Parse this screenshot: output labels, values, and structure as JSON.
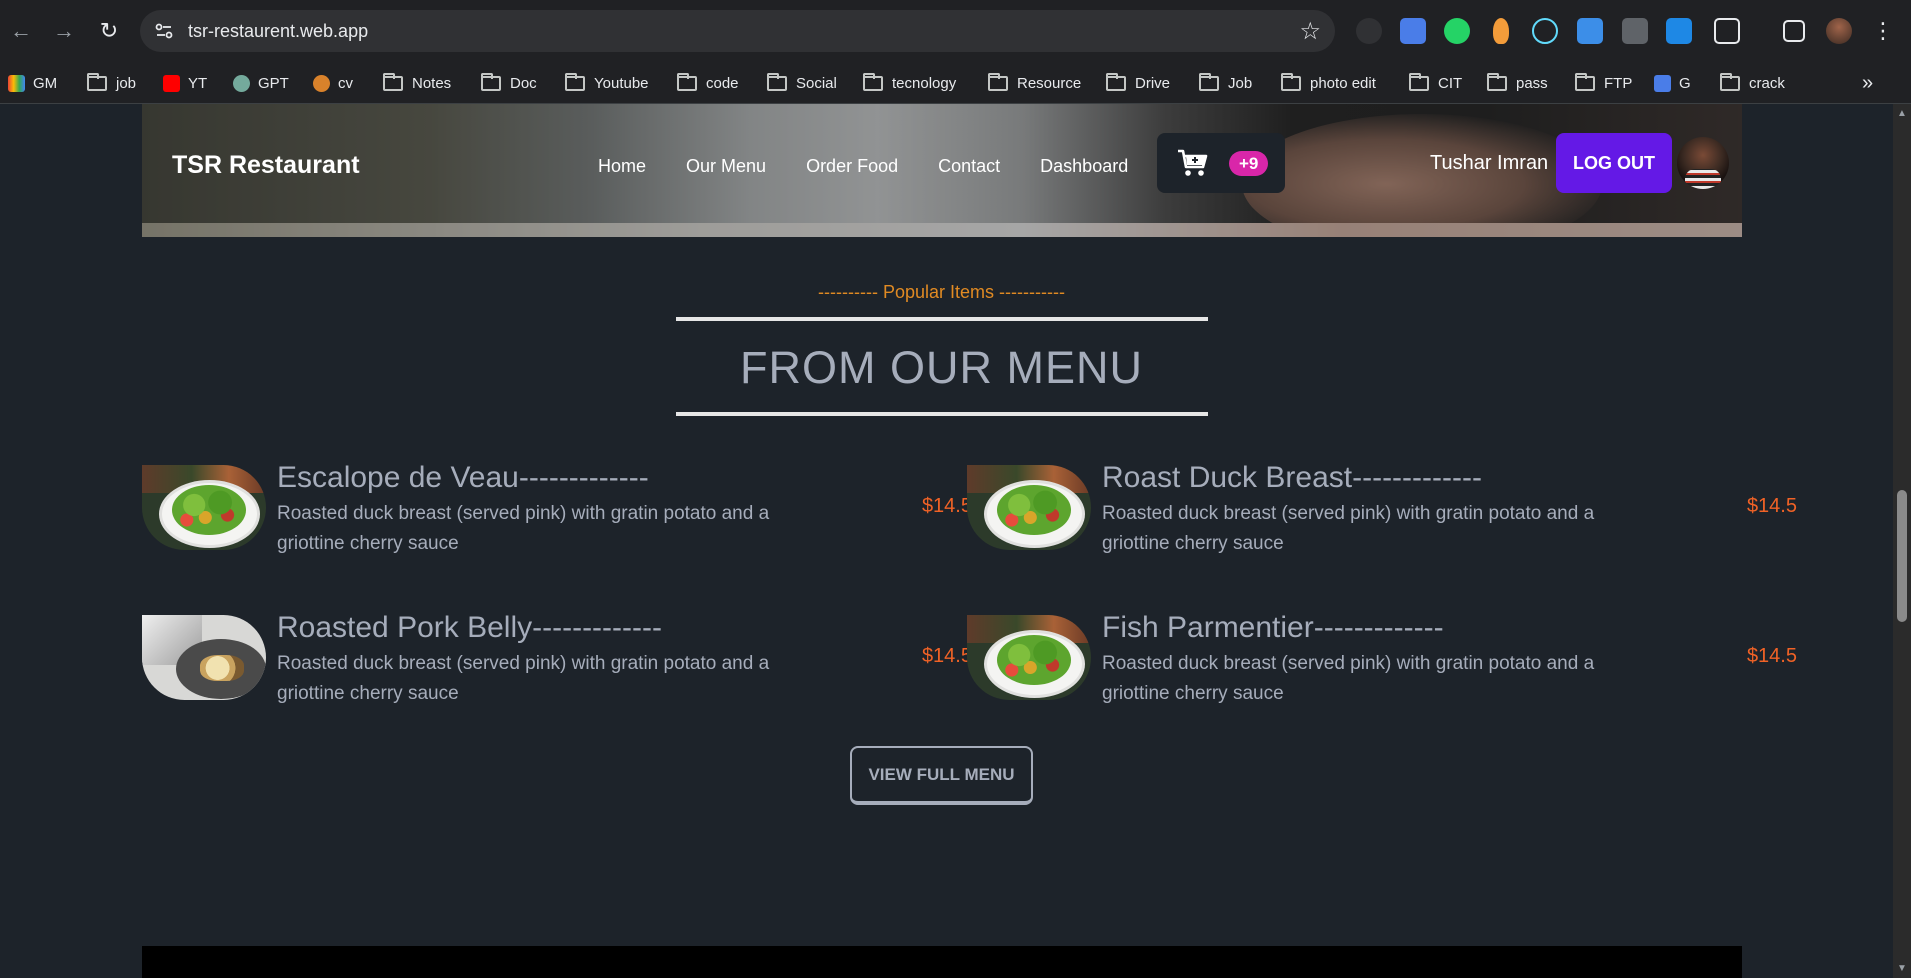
{
  "browser": {
    "url": "tsr-restaurent.web.app",
    "bookmarks": [
      "GM",
      "job",
      "YT",
      "GPT",
      "cv",
      "Notes",
      "Doc",
      "Youtube",
      "code",
      "Social",
      "tecnology",
      "Resource",
      "Drive",
      "Job",
      "photo edit",
      "CIT",
      "pass",
      "FTP",
      "G",
      "crack"
    ],
    "more_bookmarks_glyph": "»"
  },
  "navbar": {
    "brand": "TSR Restaurant",
    "links": [
      "Home",
      "Our Menu",
      "Order Food",
      "Contact",
      "Dashboard"
    ],
    "cart_count": "+9",
    "user_name": "Tushar Imran",
    "logout_label": "LOG OUT"
  },
  "section": {
    "subtitle": "---------- Popular Items -----------",
    "title": "FROM OUR MENU"
  },
  "items": [
    {
      "name": "Escalope de Veau-------------",
      "description": "Roasted duck breast (served pink) with gratin potato and a griottine cherry sauce",
      "price": "$14.5",
      "image": "salad-plate"
    },
    {
      "name": "Roast Duck Breast-------------",
      "description": "Roasted duck breast (served pink) with gratin potato and a griottine cherry sauce",
      "price": "$14.5",
      "image": "salad-plate"
    },
    {
      "name": "Roasted Pork Belly-------------",
      "description": "Roasted duck breast (served pink) with gratin potato and a griottine cherry sauce",
      "price": "$14.5",
      "image": "pork-dish"
    },
    {
      "name": "Fish Parmentier-------------",
      "description": "Roasted duck breast (served pink) with gratin potato and a griottine cherry sauce",
      "price": "$14.5",
      "image": "salad-plate"
    }
  ],
  "view_full_menu_label": "VIEW FULL MENU",
  "colors": {
    "page_bg": "#1d232a",
    "accent_orange": "#e08a23",
    "price": "#f06226",
    "logout_bg": "#6419e6",
    "cart_badge": "#d926a9"
  }
}
